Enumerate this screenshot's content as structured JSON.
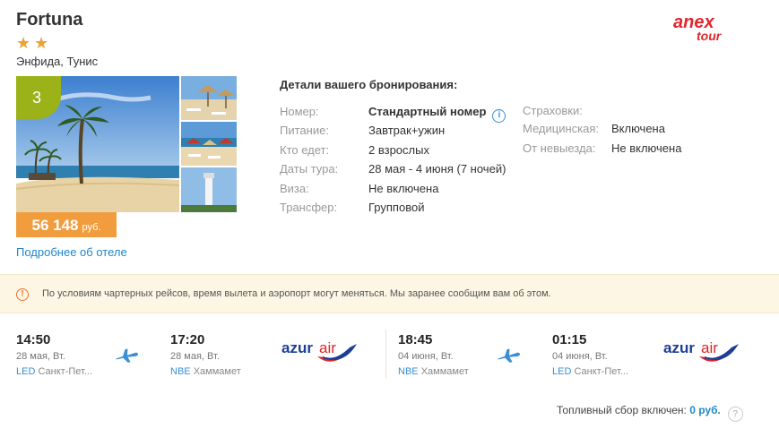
{
  "hotel": {
    "name": "Fortuna",
    "stars": 2,
    "star_glyphs": [
      "★",
      "★"
    ],
    "location": "Энфида, Тунис",
    "rating": "3",
    "price": "56 148",
    "currency": "руб.",
    "more_link": "Подробнее об отеле"
  },
  "brand": {
    "logo_top": "anex",
    "logo_bottom": "tour",
    "color_top": "#e3262e",
    "color_bottom": "#e3262e"
  },
  "booking": {
    "title": "Детали вашего бронирования:",
    "rows": [
      {
        "label": "Номер:",
        "value": "Стандартный номер"
      },
      {
        "label": "Питание:",
        "value": "Завтрак+ужин"
      },
      {
        "label": "Кто едет:",
        "value": "2 взрослых"
      },
      {
        "label": "Даты тура:",
        "value": "28 мая - 4 июня (7 ночей)"
      },
      {
        "label": "Виза:",
        "value": "Не включена"
      },
      {
        "label": "Трансфер:",
        "value": "Групповой"
      }
    ],
    "insurance": {
      "title": "Страховки:",
      "rows": [
        {
          "label": "Медицинская:",
          "value": "Включена"
        },
        {
          "label": "От невыезда:",
          "value": "Не включена"
        }
      ]
    }
  },
  "notice": {
    "text": "По условиям чартерных рейсов, время вылета и аэропорт могут меняться. Мы заранее сообщим вам об этом."
  },
  "flights": [
    {
      "dep_time": "14:50",
      "dep_date": "28 мая, Вт.",
      "dep_code": "LED",
      "dep_city": "Санкт-Пет...",
      "arr_time": "17:20",
      "arr_date": "28 мая, Вт.",
      "arr_code": "NBE",
      "arr_city": "Хаммамет",
      "airline_a": "azur",
      "airline_b": "air"
    },
    {
      "dep_time": "18:45",
      "dep_date": "04 июня, Вт.",
      "dep_code": "NBE",
      "dep_city": "Хаммамет",
      "arr_time": "01:15",
      "arr_date": "04 июня, Вт.",
      "arr_code": "LED",
      "arr_city": "Санкт-Пет...",
      "airline_a": "azur",
      "airline_b": "air"
    }
  ],
  "fuel": {
    "label": "Топливный сбор включен:",
    "value": "0 руб.",
    "help": "?"
  },
  "icons": {
    "info": "i",
    "warning": "!",
    "plane": "plane-icon"
  },
  "colors": {
    "rating_badge": "#9bb318",
    "price_tag": "#f19d3e",
    "link": "#1e86c8",
    "notice_bg": "#fdf6e4",
    "azur_blue": "#1c3f94",
    "azur_red": "#d9262e"
  }
}
